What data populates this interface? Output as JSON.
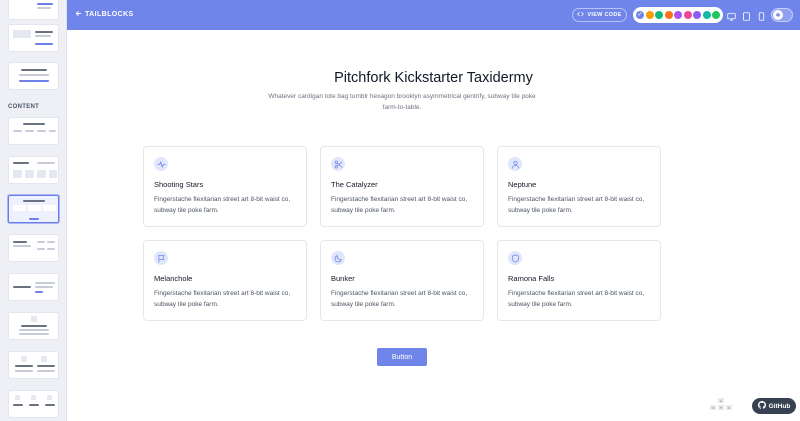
{
  "header": {
    "back_label": "TAILBLOCKS",
    "view_code_label": "VIEW CODE",
    "colors": [
      "#6f85e9",
      "#f59e0b",
      "#10b981",
      "#f97316",
      "#a855f7",
      "#ec4899",
      "#8b5cf6",
      "#14b8a6",
      "#22c55e"
    ],
    "selected_color_index": 0
  },
  "sidebar": {
    "section_label": "CONTENT"
  },
  "hero": {
    "title": "Pitchfork Kickstarter Taxidermy",
    "subtitle": "Whatever cardigan tote bag tumblr hexagon brooklyn asymmetrical gentrify, subway tile poke farm-to-table."
  },
  "cards": [
    {
      "icon": "pulse-icon",
      "title": "Shooting Stars",
      "desc": "Fingerstache flexitarian street art 8-bit waist co, subway tile poke farm."
    },
    {
      "icon": "scissors-icon",
      "title": "The Catalyzer",
      "desc": "Fingerstache flexitarian street art 8-bit waist co, subway tile poke farm."
    },
    {
      "icon": "user-icon",
      "title": "Neptune",
      "desc": "Fingerstache flexitarian street art 8-bit waist co, subway tile poke farm."
    },
    {
      "icon": "flag-icon",
      "title": "Melanchole",
      "desc": "Fingerstache flexitarian street art 8-bit waist co, subway tile poke farm."
    },
    {
      "icon": "moon-icon",
      "title": "Bunker",
      "desc": "Fingerstache flexitarian street art 8-bit waist co, subway tile poke farm."
    },
    {
      "icon": "shield-icon",
      "title": "Ramona Falls",
      "desc": "Fingerstache flexitarian street art 8-bit waist co, subway tile poke farm."
    }
  ],
  "button_label": "Button",
  "github_label": "GitHub"
}
